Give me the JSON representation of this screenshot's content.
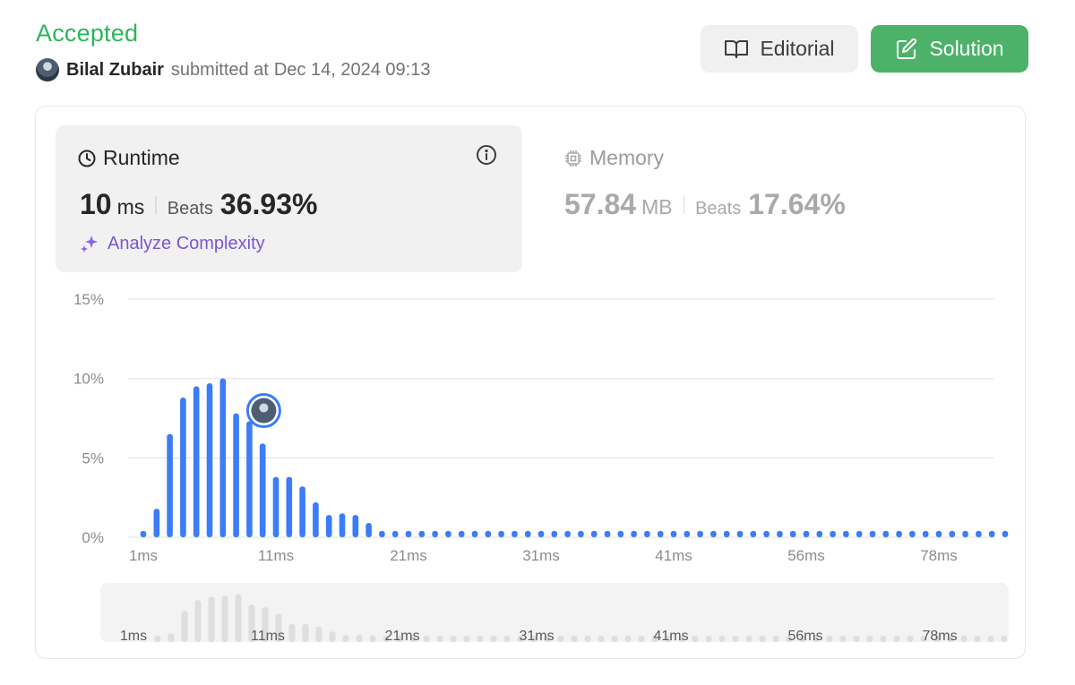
{
  "header": {
    "status": "Accepted",
    "username": "Bilal Zubair",
    "submitted_label": "submitted at",
    "timestamp": "Dec 14, 2024 09:13"
  },
  "buttons": {
    "editorial": "Editorial",
    "solution": "Solution"
  },
  "runtime": {
    "title": "Runtime",
    "value": "10",
    "unit": "ms",
    "beats_label": "Beats",
    "beats": "36.93%"
  },
  "memory": {
    "title": "Memory",
    "value": "57.84",
    "unit": "MB",
    "beats_label": "Beats",
    "beats": "17.64%"
  },
  "analyze_label": "Analyze Complexity",
  "colors": {
    "accepted": "#2db55d",
    "solution_button": "#4cb269",
    "bar": "#3b7cf7",
    "navigator_bar": "#dedede"
  },
  "chart_data": {
    "type": "bar",
    "title": "",
    "xlabel": "",
    "ylabel": "",
    "ylim": [
      0,
      15
    ],
    "y_ticks": [
      "15%",
      "10%",
      "5%",
      "0%"
    ],
    "y_tick_values": [
      15,
      10,
      5,
      0
    ],
    "x_tick_labels": [
      "1ms",
      "11ms",
      "21ms",
      "31ms",
      "41ms",
      "56ms",
      "78ms"
    ],
    "x_tick_bar_index": [
      0,
      10,
      20,
      30,
      40,
      50,
      60
    ],
    "values": [
      0.4,
      1.8,
      6.5,
      8.8,
      9.5,
      9.7,
      10.0,
      7.8,
      7.3,
      5.9,
      3.8,
      3.8,
      3.2,
      2.2,
      1.4,
      1.5,
      1.4,
      0.9,
      0.4,
      0.4,
      0.4,
      0.4,
      0.4,
      0.4,
      0.4,
      0.4,
      0.4,
      0.4,
      0.4,
      0.4,
      0.4,
      0.4,
      0.4,
      0.4,
      0.4,
      0.4,
      0.4,
      0.4,
      0.4,
      0.4,
      0.4,
      0.4,
      0.4,
      0.4,
      0.4,
      0.4,
      0.4,
      0.4,
      0.4,
      0.4,
      0.4,
      0.4,
      0.4,
      0.4,
      0.4,
      0.4,
      0.4,
      0.4,
      0.4,
      0.4,
      0.4,
      0.4,
      0.4,
      0.4,
      0.4,
      0.4
    ],
    "highlight_bar_index": 8
  },
  "navigator": {
    "x_tick_labels": [
      "1ms",
      "11ms",
      "21ms",
      "31ms",
      "41ms",
      "56ms",
      "78ms"
    ]
  }
}
